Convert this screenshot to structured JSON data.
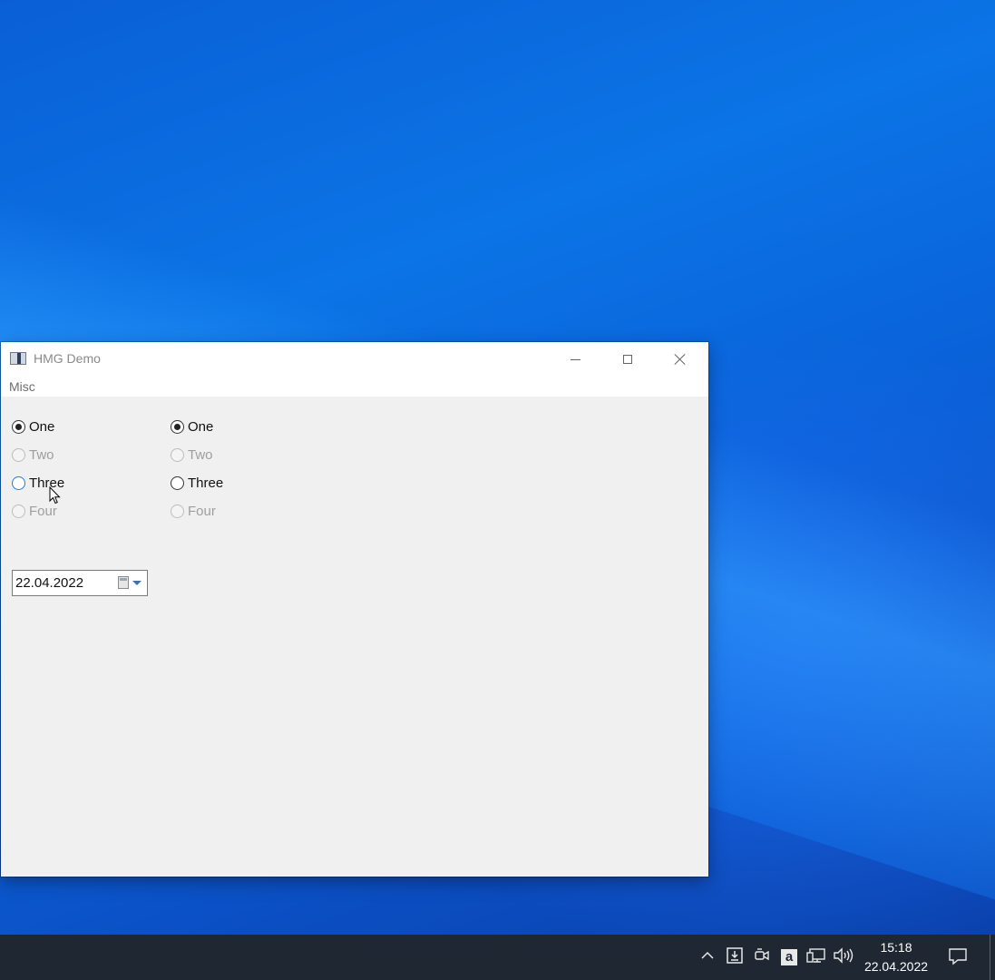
{
  "window": {
    "title": "HMG Demo",
    "menu": [
      "Misc"
    ]
  },
  "group_left": [
    {
      "label": "One",
      "checked": true,
      "enabled": true
    },
    {
      "label": "Two",
      "checked": false,
      "enabled": false
    },
    {
      "label": "Three",
      "checked": false,
      "enabled": true
    },
    {
      "label": "Four",
      "checked": false,
      "enabled": false
    }
  ],
  "group_right": [
    {
      "label": "One",
      "checked": true,
      "enabled": true
    },
    {
      "label": "Two",
      "checked": false,
      "enabled": false
    },
    {
      "label": "Three",
      "checked": false,
      "enabled": true
    },
    {
      "label": "Four",
      "checked": false,
      "enabled": false
    }
  ],
  "datepicker": {
    "value": "22.04.2022"
  },
  "taskbar": {
    "time": "15:18",
    "date": "22.04.2022",
    "a_icon_letter": "a"
  },
  "colors": {
    "accent": "#1e7fd8",
    "taskbar": "#1f2733",
    "window_bg": "#f0f0f0"
  }
}
